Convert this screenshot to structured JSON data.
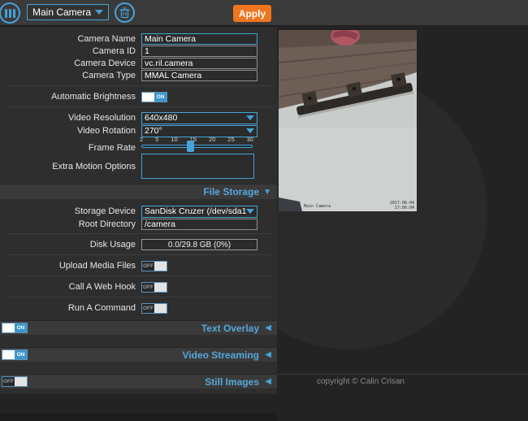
{
  "colors": {
    "accent": "#46a2d9",
    "apply_orange": "#f0751f",
    "section_title": "#55a8dc"
  },
  "icons": {
    "menu": "three-vertical-bars-in-circle",
    "trash": "trash-can-in-circle",
    "dropdown_arrow": "▼",
    "expanded_arrow": "▼",
    "collapsed_arrow": "◀"
  },
  "topbar": {
    "camera_select_value": "Main Camera",
    "apply_label": "Apply"
  },
  "settings": {
    "camera_name": {
      "label": "Camera Name",
      "value": "Main Camera"
    },
    "camera_id": {
      "label": "Camera ID",
      "value": "1"
    },
    "camera_device": {
      "label": "Camera Device",
      "value": "vc.ril.camera"
    },
    "camera_type": {
      "label": "Camera Type",
      "value": "MMAL Camera"
    },
    "automatic_brightness": {
      "label": "Automatic Brightness",
      "state": "ON"
    },
    "video_resolution": {
      "label": "Video Resolution",
      "value": "640x480"
    },
    "video_rotation": {
      "label": "Video Rotation",
      "value": "270°"
    },
    "frame_rate": {
      "label": "Frame Rate",
      "ticks": [
        "2",
        "5",
        "10",
        "15",
        "20",
        "25",
        "30"
      ],
      "value": "15"
    },
    "extra_motion_options": {
      "label": "Extra Motion Options",
      "value": ""
    }
  },
  "file_storage": {
    "title": "File Storage",
    "storage_device": {
      "label": "Storage Device",
      "value": "SanDisk Cruzer (/dev/sda1)"
    },
    "root_directory": {
      "label": "Root Directory",
      "value": "/camera"
    },
    "disk_usage": {
      "label": "Disk Usage",
      "value": "0.0/29.8 GB (0%)"
    },
    "upload_media_files": {
      "label": "Upload Media Files",
      "state": "OFF"
    },
    "call_a_web_hook": {
      "label": "Call A Web Hook",
      "state": "OFF"
    },
    "run_a_command": {
      "label": "Run A Command",
      "state": "OFF"
    }
  },
  "sections": {
    "text_overlay": {
      "title": "Text Overlay",
      "state": "ON"
    },
    "video_streaming": {
      "title": "Video Streaming",
      "state": "ON"
    },
    "still_images": {
      "title": "Still Images",
      "state": "OFF"
    }
  },
  "preview": {
    "overlay_left": "Main Camera",
    "overlay_date": "2017-06-04",
    "overlay_time": "17:06:04",
    "copyright": "copyright © Calin Crisan"
  }
}
